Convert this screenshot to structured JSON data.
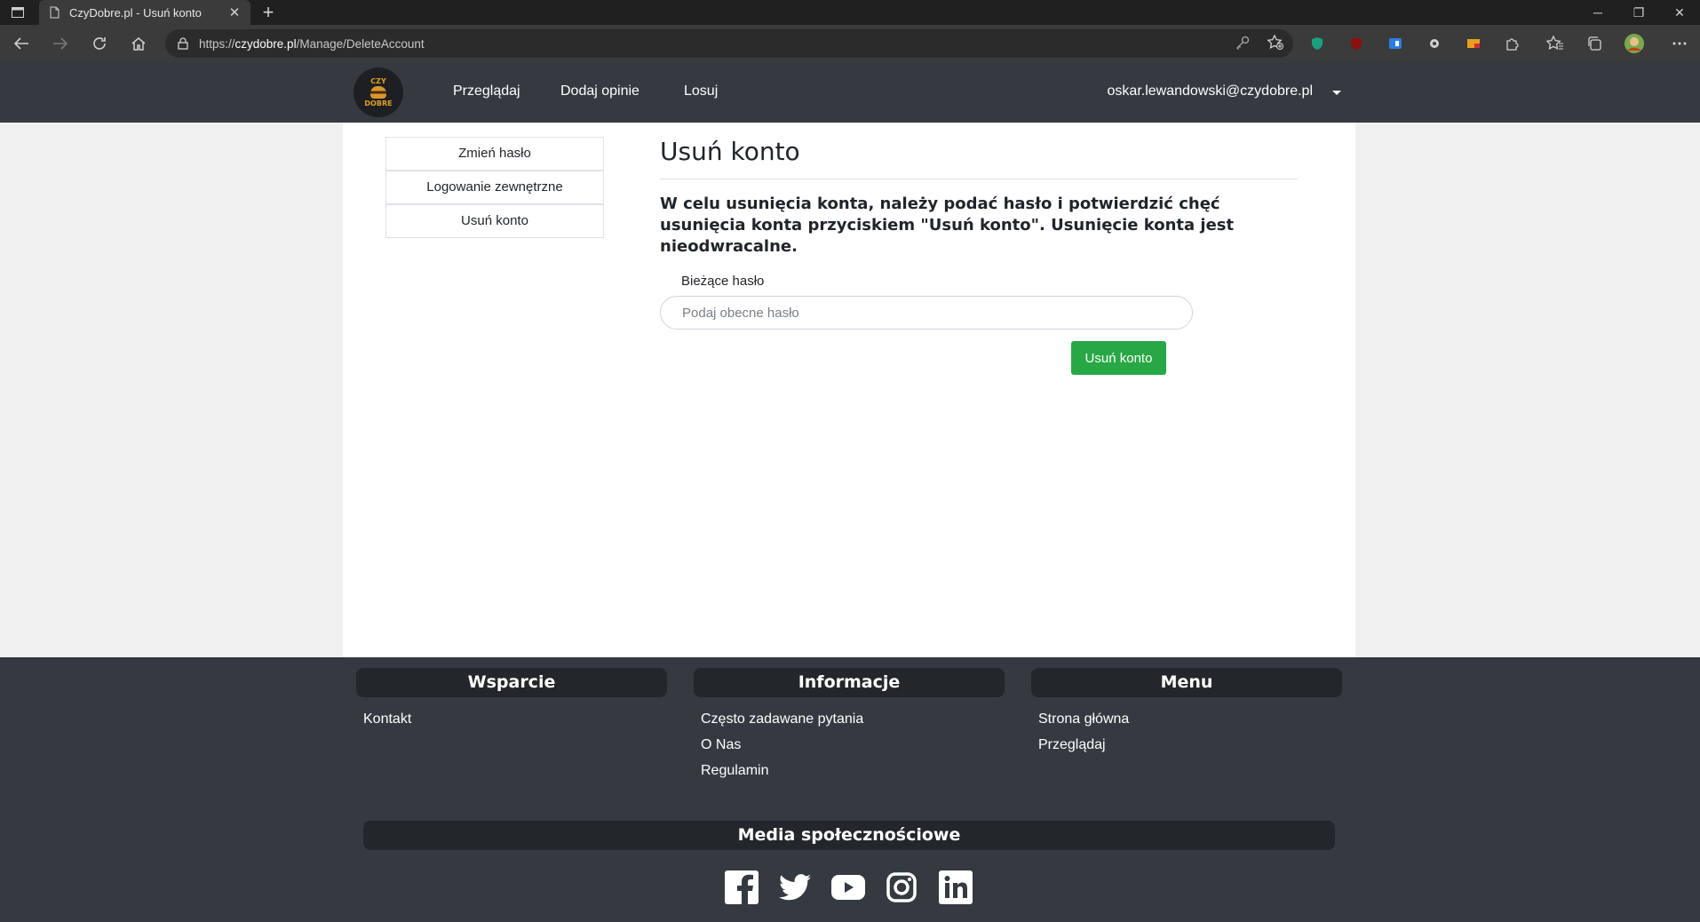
{
  "browser": {
    "tab_title": "CzyDobre.pl - Usuń konto",
    "url_prefix": "https://",
    "url_host": "czydobre.pl",
    "url_path": "/Manage/DeleteAccount"
  },
  "nav": {
    "logo_top": "CZY",
    "logo_bottom": "DOBRE",
    "links": [
      "Przeglądaj",
      "Dodaj opinie",
      "Losuj"
    ],
    "user_email": "oskar.lewandowski@czydobre.pl"
  },
  "sidebar": {
    "items": [
      {
        "label": "Zmień hasło"
      },
      {
        "label": "Logowanie zewnętrzne"
      },
      {
        "label": "Usuń konto"
      }
    ]
  },
  "content": {
    "title": "Usuń konto",
    "lead": "W celu usunięcia konta, należy podać hasło i potwierdzić chęć usunięcia konta przyciskiem \"Usuń konto\". Usunięcie konta jest nieodwracalne.",
    "password_label": "Bieżące hasło",
    "password_placeholder": "Podaj obecne hasło",
    "submit_label": "Usuń konto",
    "submit_color": "#28a745"
  },
  "footer": {
    "support": {
      "heading": "Wsparcie",
      "links": [
        "Kontakt"
      ]
    },
    "info": {
      "heading": "Informacje",
      "links": [
        "Często zadawane pytania",
        "O Nas",
        "Regulamin"
      ]
    },
    "menu": {
      "heading": "Menu",
      "links": [
        "Strona główna",
        "Przeglądaj"
      ]
    },
    "social_heading": "Media społecznościowe",
    "social_icons": [
      "facebook-icon",
      "twitter-icon",
      "youtube-icon",
      "instagram-icon",
      "linkedin-icon"
    ]
  }
}
